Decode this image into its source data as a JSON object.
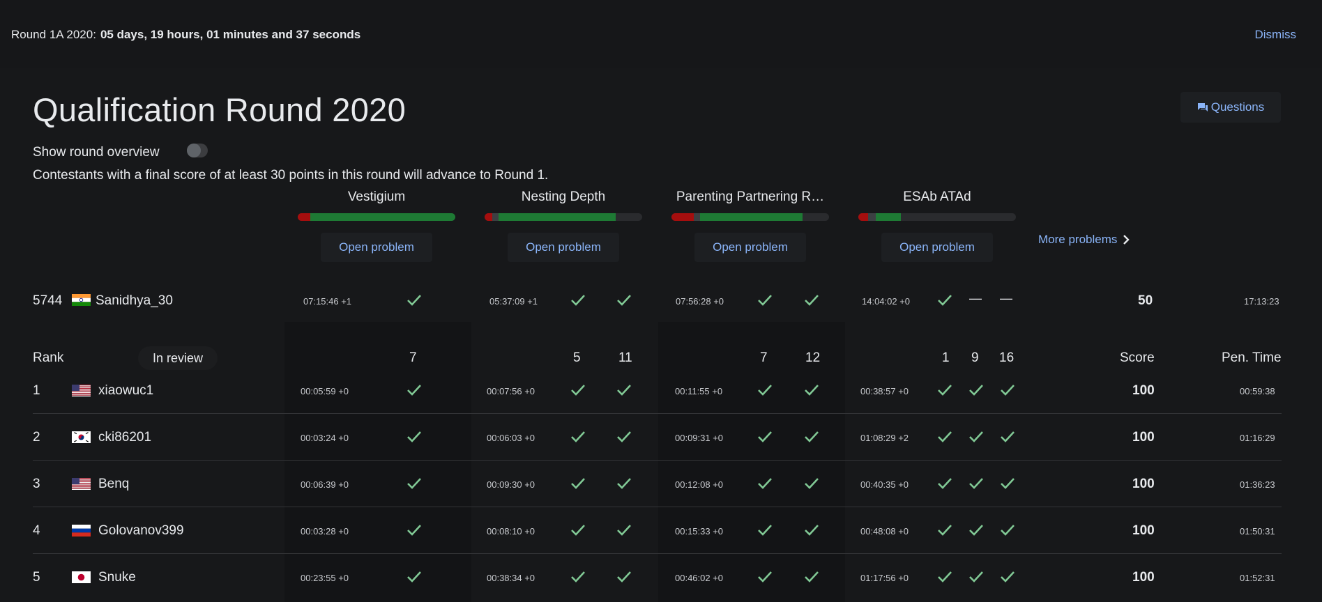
{
  "banner": {
    "round_label": "Round 1A 2020:",
    "countdown": "05 days, 19 hours, 01 minutes and 37 seconds",
    "dismiss_label": "Dismiss"
  },
  "header": {
    "title": "Qualification Round 2020",
    "questions_label": "Questions",
    "overview_label": "Show round overview",
    "overview_enabled": false,
    "info": "Contestants with a final score of at least 30 points in this round will advance to Round 1."
  },
  "problems": [
    {
      "name": "Vestigium",
      "open_label": "Open problem",
      "progress": {
        "red": 0.08,
        "gray": 0.0,
        "green": 0.92
      }
    },
    {
      "name": "Nesting Depth",
      "open_label": "Open problem",
      "progress": {
        "red": 0.05,
        "gray": 0.04,
        "green": 0.74
      }
    },
    {
      "name": "Parenting Partnering R…",
      "open_label": "Open problem",
      "progress": {
        "red": 0.14,
        "gray": 0.04,
        "green": 0.65
      }
    },
    {
      "name": "ESAb ATAd",
      "open_label": "Open problem",
      "progress": {
        "red": 0.06,
        "gray": 0.05,
        "green": 0.16
      }
    }
  ],
  "more_problems_label": "More problems",
  "current_user": {
    "rank": "5744",
    "name": "Sanidhya_30",
    "flag": "in",
    "p1_time": "07:15:46 +1",
    "p2_time": "05:37:09 +1",
    "p3_time": "07:56:28 +0",
    "p4_time": "14:04:02 +0",
    "p4_status": [
      "check",
      "dash",
      "dash"
    ],
    "score": "50",
    "penalty": "17:13:23"
  },
  "table": {
    "rank_header": "Rank",
    "in_review_label": "In review",
    "points": {
      "p1": [
        "7"
      ],
      "p2": [
        "5",
        "11"
      ],
      "p3": [
        "7",
        "12"
      ],
      "p4": [
        "1",
        "9",
        "16"
      ]
    },
    "score_header": "Score",
    "penalty_header": "Pen. Time",
    "rows": [
      {
        "rank": "1",
        "flag": "us",
        "name": "xiaowuc1",
        "t1": "00:05:59 +0",
        "t2": "00:07:56 +0",
        "t3": "00:11:55 +0",
        "t4": "00:38:57 +0",
        "score": "100",
        "penalty": "00:59:38"
      },
      {
        "rank": "2",
        "flag": "kr",
        "name": "cki86201",
        "t1": "00:03:24 +0",
        "t2": "00:06:03 +0",
        "t3": "00:09:31 +0",
        "t4": "01:08:29 +2",
        "score": "100",
        "penalty": "01:16:29"
      },
      {
        "rank": "3",
        "flag": "us",
        "name": "Benq",
        "t1": "00:06:39 +0",
        "t2": "00:09:30 +0",
        "t3": "00:12:08 +0",
        "t4": "00:40:35 +0",
        "score": "100",
        "penalty": "01:36:23"
      },
      {
        "rank": "4",
        "flag": "ru",
        "name": "Golovanov399",
        "t1": "00:03:28 +0",
        "t2": "00:08:10 +0",
        "t3": "00:15:33 +0",
        "t4": "00:48:08 +0",
        "score": "100",
        "penalty": "01:50:31"
      },
      {
        "rank": "5",
        "flag": "jp",
        "name": "Snuke",
        "t1": "00:23:55 +0",
        "t2": "00:38:34 +0",
        "t3": "00:46:02 +0",
        "t4": "01:17:56 +0",
        "score": "100",
        "penalty": "01:52:31"
      }
    ]
  },
  "colors": {
    "accent": "#8ab4f8",
    "check": "#81c995",
    "bar_red": "#a50e0e",
    "bar_green": "#1e7a34",
    "bar_gray": "#3c4043"
  }
}
